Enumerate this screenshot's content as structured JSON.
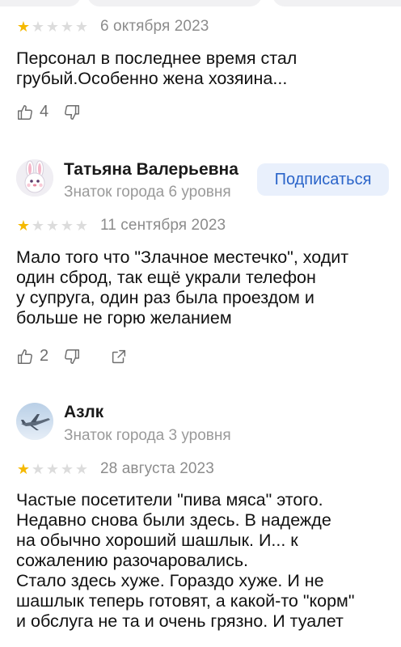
{
  "reviews": [
    {
      "rating": 1,
      "date": "6 октября 2023",
      "text": "Персонал в последнее время стал\nгрубый.Особенно жена хозяина...",
      "likes": "4"
    },
    {
      "author": {
        "name": "Татьяна Валерьевна",
        "level": "Знаток города 6 уровня",
        "avatar_icon": "bunny-avatar-icon"
      },
      "subscribe_label": "Подписаться",
      "rating": 1,
      "date": "11 сентября 2023",
      "text": "Мало того что \"Злачное местечко\", ходит\nодин сброд, так ещё украли телефон\nу супруга, один раз была проездом и\nбольше не горю желанием",
      "likes": "2"
    },
    {
      "author": {
        "name": "Азлк",
        "level": "Знаток города 3 уровня",
        "avatar_icon": "airplane-avatar-icon"
      },
      "rating": 1,
      "date": "28 августа 2023",
      "text": "Частые посетители  \"пива мяса\" этого.\nНедавно снова были здесь. В надежде\nна обычно хороший шашлык. И... к\nсожалению разочаровались.\nСтало здесь хуже. Гораздо хуже. И не\nшашлык теперь готовят, а какой-то \"корм\"\nи обслуга не та и очень грязно. И туалет"
    }
  ],
  "colors": {
    "star_on": "#f5b900",
    "star_off": "#dcdcdc",
    "subscribe_bg": "#e9f0fc",
    "subscribe_text": "#2a64c9"
  }
}
